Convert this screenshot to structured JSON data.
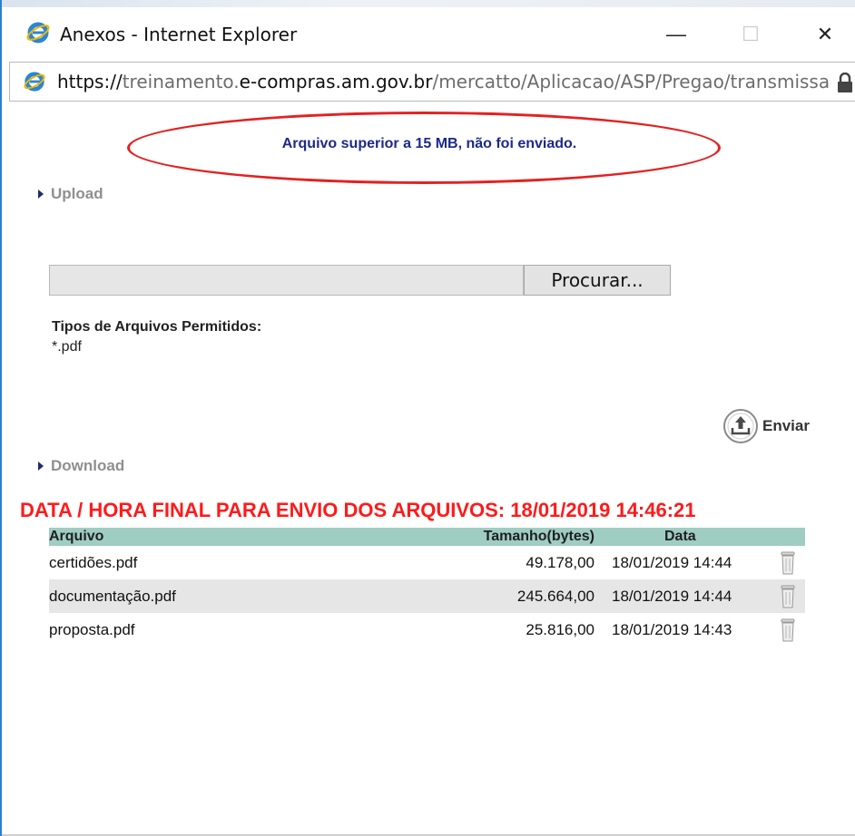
{
  "window": {
    "title": "Anexos - Internet Explorer",
    "minimize_symbol": "—",
    "maximize_symbol": "☐",
    "close_symbol": "✕"
  },
  "address": {
    "scheme": "https://",
    "sub": "treinamento.",
    "domain": "e-compras.am.gov.br",
    "path": "/mercatto/Aplicacao/ASP/Pregao/transmissa"
  },
  "message": "Arquivo superior a 15 MB, não foi enviado.",
  "upload": {
    "section_label": "Upload",
    "browse_label": "Procurar...",
    "types_title": "Tipos de Arquivos Permitidos:",
    "types_value": "*.pdf",
    "send_label": "Enviar"
  },
  "download": {
    "section_label": "Download",
    "deadline": "DATA / HORA FINAL PARA ENVIO DOS ARQUIVOS: 18/01/2019 14:46:21",
    "headers": {
      "file": "Arquivo",
      "size": "Tamanho(bytes)",
      "date": "Data"
    },
    "files": [
      {
        "name": "certidões.pdf",
        "size": "49.178,00",
        "date": "18/01/2019 14:44"
      },
      {
        "name": "documentação.pdf",
        "size": "245.664,00",
        "date": "18/01/2019 14:44"
      },
      {
        "name": "proposta.pdf",
        "size": "25.816,00",
        "date": "18/01/2019 14:43"
      }
    ]
  },
  "colors": {
    "message_text": "#1c2a8a",
    "highlight_ellipse": "#e42121",
    "deadline_text": "#ff1a1a",
    "table_header_bg": "#9fcdc2",
    "alt_row_bg": "#e6e6e6"
  },
  "icons": {
    "browser": "ie-logo-icon",
    "lock": "lock-icon",
    "send": "upload-icon",
    "delete": "trash-icon"
  }
}
